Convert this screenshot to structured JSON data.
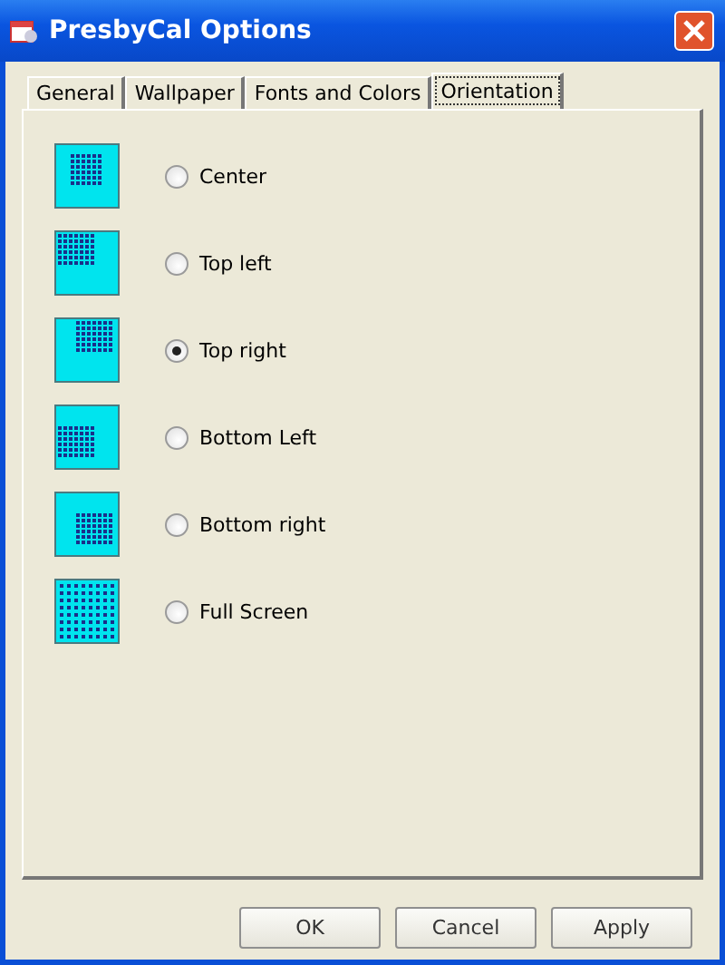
{
  "window": {
    "title": "PresbyCal Options"
  },
  "tabs": [
    {
      "label": "General",
      "selected": false
    },
    {
      "label": "Wallpaper",
      "selected": false
    },
    {
      "label": "Fonts and Colors",
      "selected": false
    },
    {
      "label": "Orientation",
      "selected": true
    }
  ],
  "options": [
    {
      "label": "Center",
      "kind": "center",
      "selected": false
    },
    {
      "label": "Top left",
      "kind": "top-left",
      "selected": false
    },
    {
      "label": "Top right",
      "kind": "top-right",
      "selected": true
    },
    {
      "label": "Bottom Left",
      "kind": "bottom-left",
      "selected": false
    },
    {
      "label": "Bottom right",
      "kind": "bottom-right",
      "selected": false
    },
    {
      "label": "Full Screen",
      "kind": "full",
      "selected": false
    }
  ],
  "buttons": [
    "OK",
    "Cancel",
    "Apply"
  ]
}
